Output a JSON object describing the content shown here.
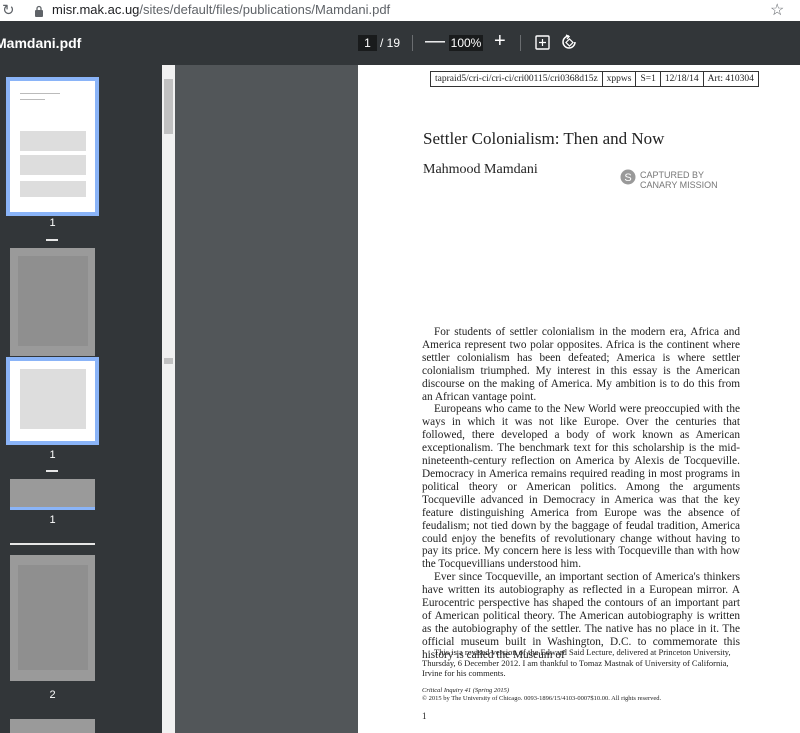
{
  "browser": {
    "url_host": "misr.mak.ac.ug",
    "url_path": "/sites/default/files/publications/Mamdani.pdf"
  },
  "toolbar": {
    "file_title": "Mamdani.pdf",
    "current_page": "1",
    "total_pages": "/ 19",
    "zoom": "100%",
    "zoom_out": "—",
    "zoom_in": "+"
  },
  "sidebar": {
    "thumbnails": [
      {
        "label": "1"
      },
      {
        "label": "1"
      },
      {
        "label": "1"
      },
      {
        "label": "2"
      }
    ]
  },
  "page": {
    "header_cells": [
      "tapraid5/cri-ci/cri-ci/cri00115/cri0368d15z",
      "xppws",
      "S=1",
      "12/18/14",
      "Art: 410304"
    ],
    "title": "Settler Colonialism: Then and Now",
    "author": "Mahmood Mamdani",
    "stamp_line1": "CAPTURED BY",
    "stamp_line2": "CANARY MISSION",
    "paragraphs": [
      "For students of settler colonialism in the modern era, Africa and America represent two polar opposites. Africa is the continent where settler colonialism has been defeated; America is where settler colonialism triumphed. My interest in this essay is the American discourse on the making of America. My ambition is to do this from an African vantage point.",
      "Europeans who came to the New World were preoccupied with the ways in which it was not like Europe. Over the centuries that followed, there developed a body of work known as American exceptionalism. The benchmark text for this scholarship is the mid-nineteenth-century reflection on America by Alexis de Tocqueville. Democracy in America remains required reading in most programs in political theory or American politics. Among the arguments Tocqueville advanced in Democracy in America was that the key feature distinguishing America from Europe was the absence of feudalism; not tied down by the baggage of feudal tradition, America could enjoy the benefits of revolutionary change without having to pay its price. My concern here is less with Tocqueville than with how the Tocquevillians understood him.",
      "Ever since Tocqueville, an important section of America's thinkers have written its autobiography as reflected in a European mirror. A Eurocentric perspective has shaped the contours of an important part of American political theory. The American autobiography is written as the autobiography of the settler. The native has no place in it. The official museum built in Washington, D.C. to commemorate this history is called the Museum of"
    ],
    "footnote": "This is a revised version of the Edward Said Lecture, delivered at Princeton University, Thursday, 6 December 2012. I am thankful to Tomaz Mastnak of University of California, Irvine for his comments.",
    "journal_line1": "Critical Inquiry 41 (Spring 2015)",
    "journal_line2": "© 2015 by The University of Chicago. 0093-1896/15/4103-0007$10.00. All rights reserved.",
    "page_number": "1"
  }
}
